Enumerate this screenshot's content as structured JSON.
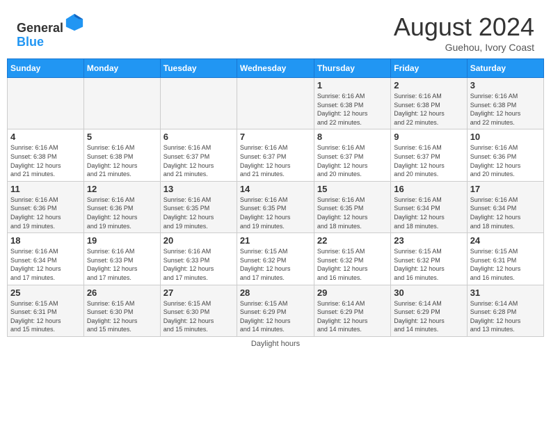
{
  "header": {
    "logo_general": "General",
    "logo_blue": "Blue",
    "month_year": "August 2024",
    "location": "Guehou, Ivory Coast"
  },
  "days_of_week": [
    "Sunday",
    "Monday",
    "Tuesday",
    "Wednesday",
    "Thursday",
    "Friday",
    "Saturday"
  ],
  "weeks": [
    [
      {
        "day": "",
        "info": ""
      },
      {
        "day": "",
        "info": ""
      },
      {
        "day": "",
        "info": ""
      },
      {
        "day": "",
        "info": ""
      },
      {
        "day": "1",
        "info": "Sunrise: 6:16 AM\nSunset: 6:38 PM\nDaylight: 12 hours\nand 22 minutes."
      },
      {
        "day": "2",
        "info": "Sunrise: 6:16 AM\nSunset: 6:38 PM\nDaylight: 12 hours\nand 22 minutes."
      },
      {
        "day": "3",
        "info": "Sunrise: 6:16 AM\nSunset: 6:38 PM\nDaylight: 12 hours\nand 22 minutes."
      }
    ],
    [
      {
        "day": "4",
        "info": "Sunrise: 6:16 AM\nSunset: 6:38 PM\nDaylight: 12 hours\nand 21 minutes."
      },
      {
        "day": "5",
        "info": "Sunrise: 6:16 AM\nSunset: 6:38 PM\nDaylight: 12 hours\nand 21 minutes."
      },
      {
        "day": "6",
        "info": "Sunrise: 6:16 AM\nSunset: 6:37 PM\nDaylight: 12 hours\nand 21 minutes."
      },
      {
        "day": "7",
        "info": "Sunrise: 6:16 AM\nSunset: 6:37 PM\nDaylight: 12 hours\nand 21 minutes."
      },
      {
        "day": "8",
        "info": "Sunrise: 6:16 AM\nSunset: 6:37 PM\nDaylight: 12 hours\nand 20 minutes."
      },
      {
        "day": "9",
        "info": "Sunrise: 6:16 AM\nSunset: 6:37 PM\nDaylight: 12 hours\nand 20 minutes."
      },
      {
        "day": "10",
        "info": "Sunrise: 6:16 AM\nSunset: 6:36 PM\nDaylight: 12 hours\nand 20 minutes."
      }
    ],
    [
      {
        "day": "11",
        "info": "Sunrise: 6:16 AM\nSunset: 6:36 PM\nDaylight: 12 hours\nand 19 minutes."
      },
      {
        "day": "12",
        "info": "Sunrise: 6:16 AM\nSunset: 6:36 PM\nDaylight: 12 hours\nand 19 minutes."
      },
      {
        "day": "13",
        "info": "Sunrise: 6:16 AM\nSunset: 6:35 PM\nDaylight: 12 hours\nand 19 minutes."
      },
      {
        "day": "14",
        "info": "Sunrise: 6:16 AM\nSunset: 6:35 PM\nDaylight: 12 hours\nand 19 minutes."
      },
      {
        "day": "15",
        "info": "Sunrise: 6:16 AM\nSunset: 6:35 PM\nDaylight: 12 hours\nand 18 minutes."
      },
      {
        "day": "16",
        "info": "Sunrise: 6:16 AM\nSunset: 6:34 PM\nDaylight: 12 hours\nand 18 minutes."
      },
      {
        "day": "17",
        "info": "Sunrise: 6:16 AM\nSunset: 6:34 PM\nDaylight: 12 hours\nand 18 minutes."
      }
    ],
    [
      {
        "day": "18",
        "info": "Sunrise: 6:16 AM\nSunset: 6:34 PM\nDaylight: 12 hours\nand 17 minutes."
      },
      {
        "day": "19",
        "info": "Sunrise: 6:16 AM\nSunset: 6:33 PM\nDaylight: 12 hours\nand 17 minutes."
      },
      {
        "day": "20",
        "info": "Sunrise: 6:16 AM\nSunset: 6:33 PM\nDaylight: 12 hours\nand 17 minutes."
      },
      {
        "day": "21",
        "info": "Sunrise: 6:15 AM\nSunset: 6:32 PM\nDaylight: 12 hours\nand 17 minutes."
      },
      {
        "day": "22",
        "info": "Sunrise: 6:15 AM\nSunset: 6:32 PM\nDaylight: 12 hours\nand 16 minutes."
      },
      {
        "day": "23",
        "info": "Sunrise: 6:15 AM\nSunset: 6:32 PM\nDaylight: 12 hours\nand 16 minutes."
      },
      {
        "day": "24",
        "info": "Sunrise: 6:15 AM\nSunset: 6:31 PM\nDaylight: 12 hours\nand 16 minutes."
      }
    ],
    [
      {
        "day": "25",
        "info": "Sunrise: 6:15 AM\nSunset: 6:31 PM\nDaylight: 12 hours\nand 15 minutes."
      },
      {
        "day": "26",
        "info": "Sunrise: 6:15 AM\nSunset: 6:30 PM\nDaylight: 12 hours\nand 15 minutes."
      },
      {
        "day": "27",
        "info": "Sunrise: 6:15 AM\nSunset: 6:30 PM\nDaylight: 12 hours\nand 15 minutes."
      },
      {
        "day": "28",
        "info": "Sunrise: 6:15 AM\nSunset: 6:29 PM\nDaylight: 12 hours\nand 14 minutes."
      },
      {
        "day": "29",
        "info": "Sunrise: 6:14 AM\nSunset: 6:29 PM\nDaylight: 12 hours\nand 14 minutes."
      },
      {
        "day": "30",
        "info": "Sunrise: 6:14 AM\nSunset: 6:29 PM\nDaylight: 12 hours\nand 14 minutes."
      },
      {
        "day": "31",
        "info": "Sunrise: 6:14 AM\nSunset: 6:28 PM\nDaylight: 12 hours\nand 13 minutes."
      }
    ]
  ],
  "footer": {
    "daylight_label": "Daylight hours"
  }
}
